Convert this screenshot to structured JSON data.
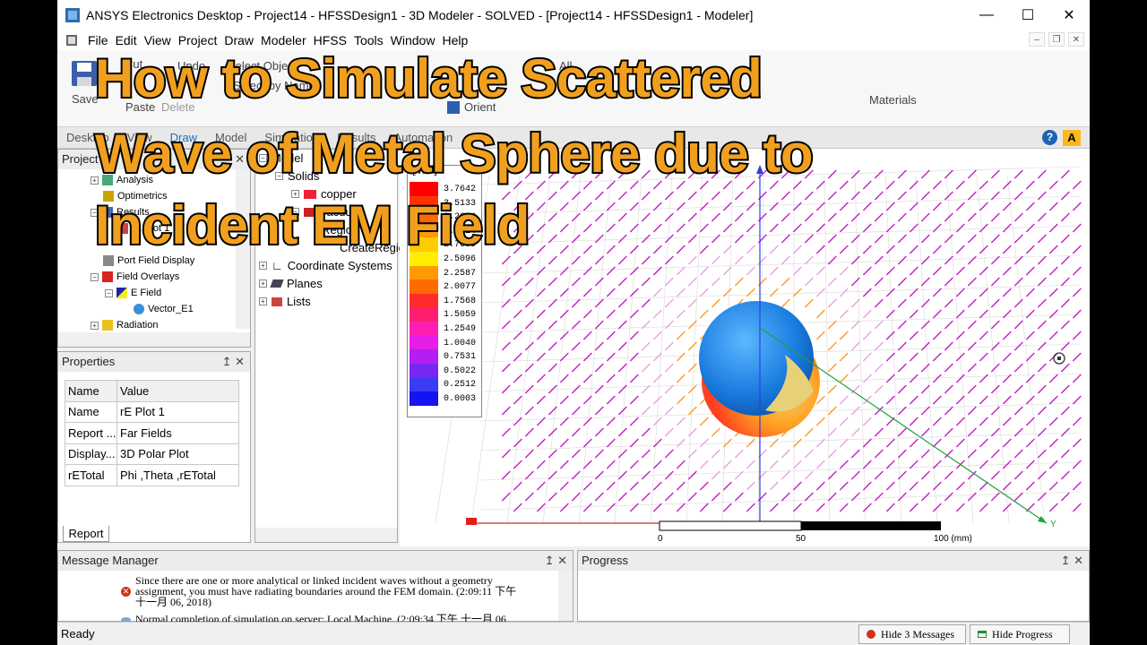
{
  "window": {
    "title": "ANSYS Electronics Desktop - Project14 - HFSSDesign1 - 3D Modeler - SOLVED - [Project14 - HFSSDesign1 - Modeler]"
  },
  "menu": [
    "File",
    "Edit",
    "View",
    "Project",
    "Draw",
    "Modeler",
    "HFSS",
    "Tools",
    "Window",
    "Help"
  ],
  "ribbon": {
    "save": "Save",
    "undo": "Undo",
    "paste": "Paste",
    "delete": "Delete",
    "select_object": "Select Object",
    "select_by_name": "Select by Name",
    "orient": "Orient",
    "all": "All",
    "materials": "Materials",
    "draw_label": "Draw",
    "cut": "Cut"
  },
  "tabs": [
    "Desktop",
    "View",
    "Draw",
    "Model",
    "Simulation",
    "Results",
    "Automation"
  ],
  "active_tab": "Draw",
  "project_panel": {
    "title": "Project",
    "items": [
      {
        "label": "Analysis",
        "level": 1
      },
      {
        "label": "Optimetrics",
        "level": 1
      },
      {
        "label": "Results",
        "level": 1
      },
      {
        "label": "rE Plot 1",
        "level": 2
      },
      {
        "label": "Port Field Display",
        "level": 1
      },
      {
        "label": "Field Overlays",
        "level": 1
      },
      {
        "label": "E Field",
        "level": 2
      },
      {
        "label": "Vector_E1",
        "level": 3
      },
      {
        "label": "Radiation",
        "level": 1
      }
    ]
  },
  "model_tree": {
    "items": [
      {
        "label": "Model",
        "level": 0
      },
      {
        "label": "Solids",
        "level": 1
      },
      {
        "label": "copper",
        "level": 2
      },
      {
        "label": "vacuum",
        "level": 2
      },
      {
        "label": "Region",
        "level": 3
      },
      {
        "label": "CreateRegion",
        "level": 3
      },
      {
        "label": "Coordinate Systems",
        "level": 0
      },
      {
        "label": "Planes",
        "level": 0
      },
      {
        "label": "Lists",
        "level": 0
      }
    ]
  },
  "properties": {
    "title": "Properties",
    "headers": [
      "Name",
      "Value"
    ],
    "rows": [
      [
        "Name",
        "rE Plot 1"
      ],
      [
        "Report ...",
        "Far Fields"
      ],
      [
        "Display...",
        "3D Polar Plot"
      ],
      [
        "rETotal",
        "Phi ,Theta ,rETotal"
      ]
    ],
    "tab": "Report"
  },
  "legend": {
    "unit": "[V/m]",
    "values": [
      "3.7642",
      "3.5133",
      "3.2624",
      "3.0114",
      "2.7605",
      "2.5096",
      "2.2587",
      "2.0077",
      "1.7568",
      "1.5059",
      "1.2549",
      "1.0040",
      "0.7531",
      "0.5022",
      "0.2512",
      "0.0003"
    ],
    "colors": [
      "#ff0000",
      "#ff3300",
      "#ff6600",
      "#ff9900",
      "#ffcc00",
      "#ffee00",
      "#ff9a00",
      "#ff6a00",
      "#ff2a2a",
      "#ff1e6e",
      "#ff1eb4",
      "#e61ee6",
      "#b41ef0",
      "#7828f5",
      "#3c3cf5",
      "#1414f0"
    ]
  },
  "scale_bar": {
    "labels": [
      "0",
      "50",
      "100 (mm)"
    ]
  },
  "axis_label_y": "Y",
  "message_manager": {
    "title": "Message Manager",
    "messages": [
      {
        "type": "error",
        "text": "Since there are one or more analytical or linked incident waves without a geometry assignment, you must have radiating boundaries around the FEM domain. (2:09:11 下午 十一月 06, 2018)"
      },
      {
        "type": "info",
        "text": "Normal completion of simulation on server: Local Machine. (2:09:34 下午 十一月 06"
      }
    ]
  },
  "progress": {
    "title": "Progress"
  },
  "status": {
    "text": "Ready",
    "hide_messages": "Hide 3 Messages",
    "hide_progress": "Hide Progress"
  },
  "overlay": {
    "lines": [
      "How to Simulate Scattered",
      "Wave of Metal Sphere due to",
      "Incident EM Field"
    ]
  },
  "colors": {
    "accent": "#1b6fc3",
    "overlay_text": "#f0a01e",
    "arrow": "#c020c0"
  }
}
